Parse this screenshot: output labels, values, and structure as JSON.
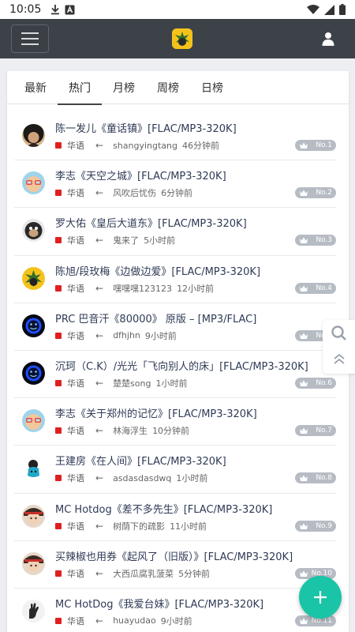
{
  "status_bar": {
    "time": "10:05"
  },
  "tabs": [
    {
      "label": "最新"
    },
    {
      "label": "热门"
    },
    {
      "label": "月榜"
    },
    {
      "label": "周榜"
    },
    {
      "label": "日榜"
    }
  ],
  "active_tab": "热门",
  "items": [
    {
      "title": "陈一发儿《童话镇》[FLAC/MP3-320K]",
      "lang": "华语",
      "user": "shangyingtang",
      "time": "46分钟前",
      "rank": "No.1",
      "avatar": "avatar-dark-hair"
    },
    {
      "title": "李志《天空之城》[FLAC/MP3-320K]",
      "lang": "华语",
      "user": "风吹后忧伤",
      "time": "6分钟前",
      "rank": "No.2",
      "avatar": "avatar-glasses-cartoon"
    },
    {
      "title": "罗大佑《皇后大道东》[FLAC/MP3-320K]",
      "lang": "华语",
      "user": "鬼来了",
      "time": "5小时前",
      "rank": "No.3",
      "avatar": "avatar-monkey"
    },
    {
      "title": "陈旭/段玫梅《边做边爱》[FLAC/MP3-320K]",
      "lang": "华语",
      "user": "嘿嘿嘿123123",
      "time": "12小时前",
      "rank": "No.4",
      "avatar": "avatar-yellow-plant"
    },
    {
      "title": "PRC 巴音汗《80000》 原版 – [MP3/FLAC]",
      "lang": "华语",
      "user": "dfhjhn",
      "time": "9小时前",
      "rank": "No.5",
      "avatar": "avatar-blue-face"
    },
    {
      "title": "沉珂（C.K）/光光「飞向别人的床」[FLAC/MP3-320K]",
      "lang": "华语",
      "user": "楚楚song",
      "time": "1小时前",
      "rank": "No.6",
      "avatar": "avatar-blue-face"
    },
    {
      "title": "李志《关于郑州的记忆》[FLAC/MP3-320K]",
      "lang": "华语",
      "user": "林海浮生",
      "time": "10分钟前",
      "rank": "No.7",
      "avatar": "avatar-glasses-cartoon"
    },
    {
      "title": "王建房《在人间》[FLAC/MP3-320K]",
      "lang": "华语",
      "user": "asdasdasdwq",
      "time": "1小时前",
      "rank": "No.8",
      "avatar": "avatar-blue-creature"
    },
    {
      "title": "MC Hotdog《差不多先生》[FLAC/MP3-320K]",
      "lang": "华语",
      "user": "树荫下的疏影",
      "time": "11小时前",
      "rank": "No.9",
      "avatar": "avatar-anime-red"
    },
    {
      "title": "买辣椒也用券《起风了（旧版）》[FLAC/MP3-320K]",
      "lang": "华语",
      "user": "大西瓜腐乳菠菜",
      "time": "5分钟前",
      "rank": "No.10",
      "avatar": "avatar-anime-red"
    },
    {
      "title": "MC HotDog《我爱台妹》[FLAC/MP3-320K]",
      "lang": "华语",
      "user": "huayudao",
      "time": "9小时前",
      "rank": "No.11",
      "avatar": "avatar-hand-gesture"
    }
  ],
  "colors": {
    "app_bar": "#3c4248",
    "accent": "#19c5a6",
    "lang_dot": "#e02020",
    "badge": "#b7bcc4",
    "title_text": "#2e3a55"
  },
  "icons": [
    "menu-icon",
    "app-logo-icon",
    "user-icon",
    "search-icon",
    "scroll-top-icon",
    "add-icon",
    "crown-icon",
    "arrow-left-icon"
  ]
}
